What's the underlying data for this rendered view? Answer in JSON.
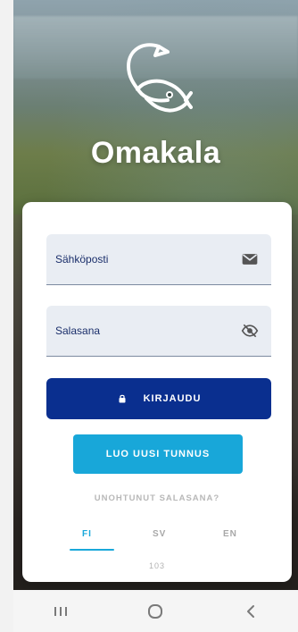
{
  "app": {
    "title": "Omakala"
  },
  "login": {
    "email_label": "Sähköposti",
    "password_label": "Salasana",
    "login_button": "KIRJAUDU",
    "create_account_button": "LUO UUSI TUNNUS",
    "forgot_password": "UNOHTUNUT SALASANA?",
    "version": "103"
  },
  "languages": [
    {
      "code": "FI",
      "selected": true
    },
    {
      "code": "SV",
      "selected": false
    },
    {
      "code": "EN",
      "selected": false
    }
  ],
  "icons": {
    "logo": "fish-hook-logo",
    "email": "mail-icon",
    "password_visibility": "eye-off-icon",
    "lock": "lock-icon"
  },
  "colors": {
    "primary": "#0a2f8f",
    "secondary": "#18a7d9",
    "field_bg": "#e9edf3",
    "text_label": "#1b2f6b",
    "accent": "#1aa8da"
  },
  "system_nav": {
    "recent": "recent-apps-icon",
    "home": "home-icon",
    "back": "back-icon"
  }
}
